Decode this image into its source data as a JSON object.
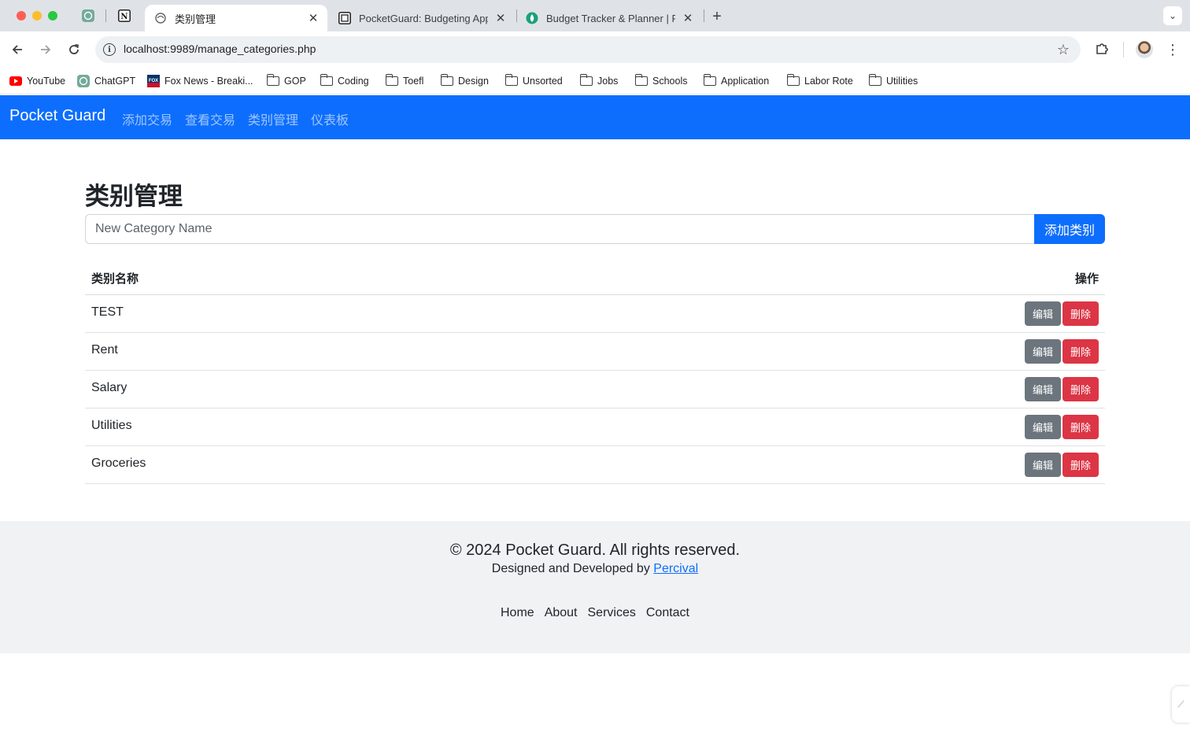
{
  "browser": {
    "tabs": [
      {
        "title": "类别管理",
        "active": true
      },
      {
        "title": "PocketGuard: Budgeting App",
        "active": false
      },
      {
        "title": "Budget Tracker & Planner | Fr",
        "active": false
      }
    ],
    "url": "localhost:9989/manage_categories.php",
    "bookmarks": [
      "YouTube",
      "ChatGPT",
      "Fox News - Breaki...",
      "GOP",
      "Coding",
      "Toefl",
      "Design",
      "Unsorted",
      "Jobs",
      "Schools",
      "Application",
      "Labor Rote",
      "Utilities"
    ]
  },
  "navbar": {
    "brand": "Pocket Guard",
    "links": [
      "添加交易",
      "查看交易",
      "类别管理",
      "仪表板"
    ],
    "bg_color": "#0d6efd"
  },
  "main": {
    "title": "类别管理",
    "input_placeholder": "New Category Name",
    "add_button": "添加类别",
    "table": {
      "headers": [
        "类别名称",
        "操作"
      ],
      "rows": [
        {
          "name": "TEST",
          "edit": "编辑",
          "delete": "删除"
        },
        {
          "name": "Rent",
          "edit": "编辑",
          "delete": "删除"
        },
        {
          "name": "Salary",
          "edit": "编辑",
          "delete": "删除"
        },
        {
          "name": "Utilities",
          "edit": "编辑",
          "delete": "删除"
        },
        {
          "name": "Groceries",
          "edit": "编辑",
          "delete": "删除"
        }
      ]
    }
  },
  "footer": {
    "copyright": "© 2024 Pocket Guard. All rights reserved.",
    "credit_prefix": "Designed and Developed by",
    "credit_link": "Percival",
    "links": [
      "Home",
      "About",
      "Services",
      "Contact"
    ]
  }
}
